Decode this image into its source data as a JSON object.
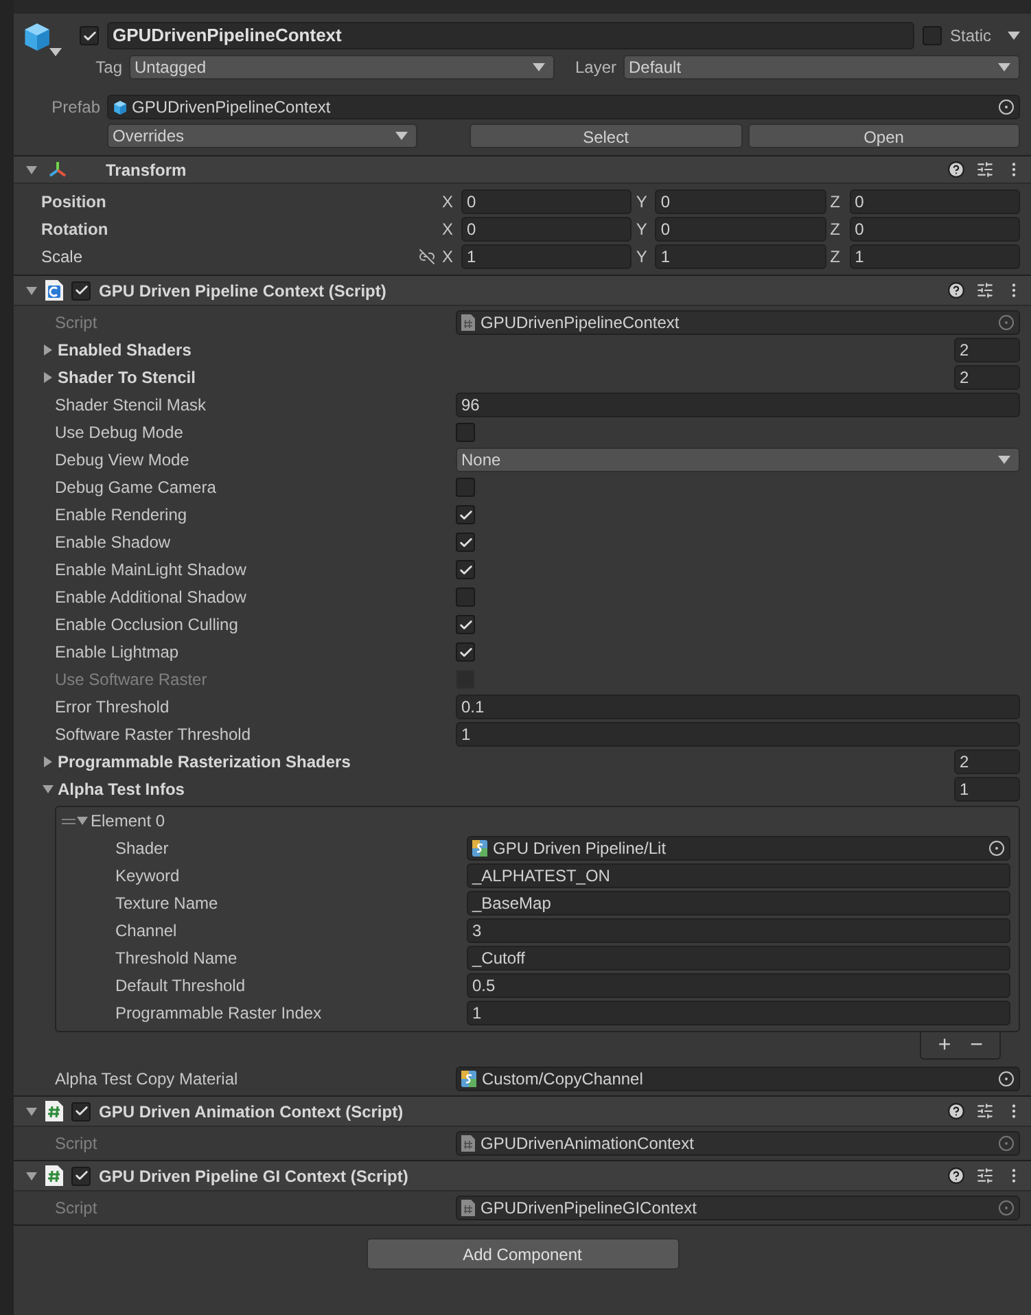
{
  "header": {
    "active": true,
    "name": "GPUDrivenPipelineContext",
    "static_label": "Static",
    "static": false,
    "tag_label": "Tag",
    "tag": "Untagged",
    "layer_label": "Layer",
    "layer": "Default",
    "prefab_label": "Prefab",
    "prefab": "GPUDrivenPipelineContext",
    "overrides": "Overrides",
    "select": "Select",
    "open": "Open"
  },
  "transform": {
    "title": "Transform",
    "expanded": true,
    "rows": [
      {
        "label": "Position",
        "bold": true,
        "linked": false,
        "values": [
          {
            "axis": "X",
            "value": "0"
          },
          {
            "axis": "Y",
            "value": "0"
          },
          {
            "axis": "Z",
            "value": "0"
          }
        ]
      },
      {
        "label": "Rotation",
        "bold": true,
        "linked": false,
        "values": [
          {
            "axis": "X",
            "value": "0"
          },
          {
            "axis": "Y",
            "value": "0"
          },
          {
            "axis": "Z",
            "value": "0"
          }
        ]
      },
      {
        "label": "Scale",
        "bold": false,
        "linked": true,
        "values": [
          {
            "axis": "X",
            "value": "1"
          },
          {
            "axis": "Y",
            "value": "1"
          },
          {
            "axis": "Z",
            "value": "1"
          }
        ]
      }
    ]
  },
  "components": [
    {
      "title": "GPU Driven Pipeline Context (Script)",
      "enabled": true,
      "expanded": true,
      "properties": [
        {
          "kind": "object",
          "label": "Script",
          "value": "GPUDrivenPipelineContext",
          "disabled": true
        },
        {
          "kind": "array",
          "label": "Enabled Shaders",
          "count": "2",
          "expanded": false
        },
        {
          "kind": "array",
          "label": "Shader To Stencil",
          "count": "2",
          "expanded": false
        },
        {
          "kind": "field",
          "label": "Shader Stencil Mask",
          "value": "96"
        },
        {
          "kind": "checkbox",
          "label": "Use Debug Mode",
          "checked": false,
          "disabled": false
        },
        {
          "kind": "dropdown",
          "label": "Debug View Mode",
          "value": "None"
        },
        {
          "kind": "checkbox",
          "label": "Debug Game Camera",
          "checked": false,
          "disabled": false
        },
        {
          "kind": "checkbox",
          "label": "Enable Rendering",
          "checked": true,
          "disabled": false
        },
        {
          "kind": "checkbox",
          "label": "Enable Shadow",
          "checked": true,
          "disabled": false
        },
        {
          "kind": "checkbox",
          "label": "Enable MainLight Shadow",
          "checked": true,
          "disabled": false
        },
        {
          "kind": "checkbox",
          "label": "Enable Additional Shadow",
          "checked": false,
          "disabled": false
        },
        {
          "kind": "checkbox",
          "label": "Enable Occlusion Culling",
          "checked": true,
          "disabled": false
        },
        {
          "kind": "checkbox",
          "label": "Enable Lightmap",
          "checked": true,
          "disabled": false
        },
        {
          "kind": "checkbox",
          "label": "Use Software Raster",
          "checked": false,
          "disabled": true
        },
        {
          "kind": "field",
          "label": "Error Threshold",
          "value": "0.1"
        },
        {
          "kind": "field",
          "label": "Software Raster Threshold",
          "value": "1"
        },
        {
          "kind": "array",
          "label": "Programmable Rasterization Shaders",
          "count": "2",
          "expanded": false
        },
        {
          "kind": "array",
          "label": "Alpha Test Infos",
          "count": "1",
          "expanded": true,
          "elements": [
            {
              "label": "Element 0",
              "expanded": true,
              "fields": [
                {
                  "kind": "object",
                  "label": "Shader",
                  "value": "GPU Driven Pipeline/Lit",
                  "disabled": false
                },
                {
                  "kind": "field",
                  "label": "Keyword",
                  "value": "_ALPHATEST_ON"
                },
                {
                  "kind": "field",
                  "label": "Texture Name",
                  "value": "_BaseMap"
                },
                {
                  "kind": "field",
                  "label": "Channel",
                  "value": "3"
                },
                {
                  "kind": "field",
                  "label": "Threshold Name",
                  "value": "_Cutoff"
                },
                {
                  "kind": "field",
                  "label": "Default Threshold",
                  "value": "0.5"
                },
                {
                  "kind": "field",
                  "label": "Programmable Raster Index",
                  "value": "1"
                }
              ]
            }
          ],
          "add": "+",
          "remove": "−"
        },
        {
          "kind": "object",
          "label": "Alpha Test Copy Material",
          "value": "Custom/CopyChannel",
          "disabled": false
        }
      ]
    },
    {
      "title": "GPU Driven Animation Context (Script)",
      "enabled": true,
      "expanded": true,
      "properties": [
        {
          "kind": "object",
          "label": "Script",
          "value": "GPUDrivenAnimationContext",
          "disabled": true
        }
      ]
    },
    {
      "title": "GPU Driven Pipeline GI Context (Script)",
      "enabled": true,
      "expanded": true,
      "properties": [
        {
          "kind": "object",
          "label": "Script",
          "value": "GPUDrivenPipelineGIContext",
          "disabled": true
        }
      ]
    }
  ],
  "add_component": "Add Component"
}
